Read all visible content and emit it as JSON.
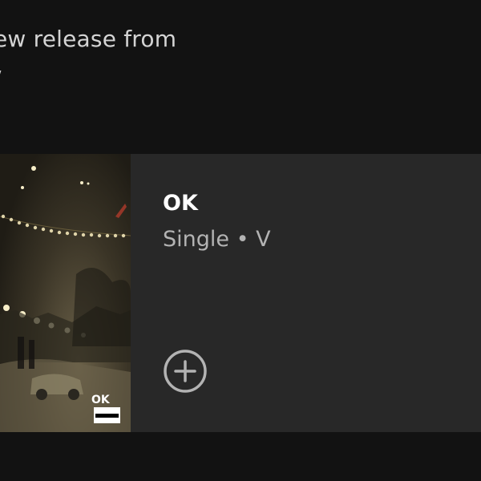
{
  "header": {
    "line1": "ew release from",
    "line2": "/"
  },
  "release": {
    "title": "OK",
    "subtitle": "Single • V",
    "cover_logo_text": "OK",
    "cover_advisory_text": "PARENTAL ADVISORY"
  },
  "actions": {
    "add_icon": "plus-circle-icon"
  },
  "colors": {
    "background": "#121212",
    "card": "#282828",
    "title": "#ffffff",
    "subtitle": "#b3b3b3"
  }
}
